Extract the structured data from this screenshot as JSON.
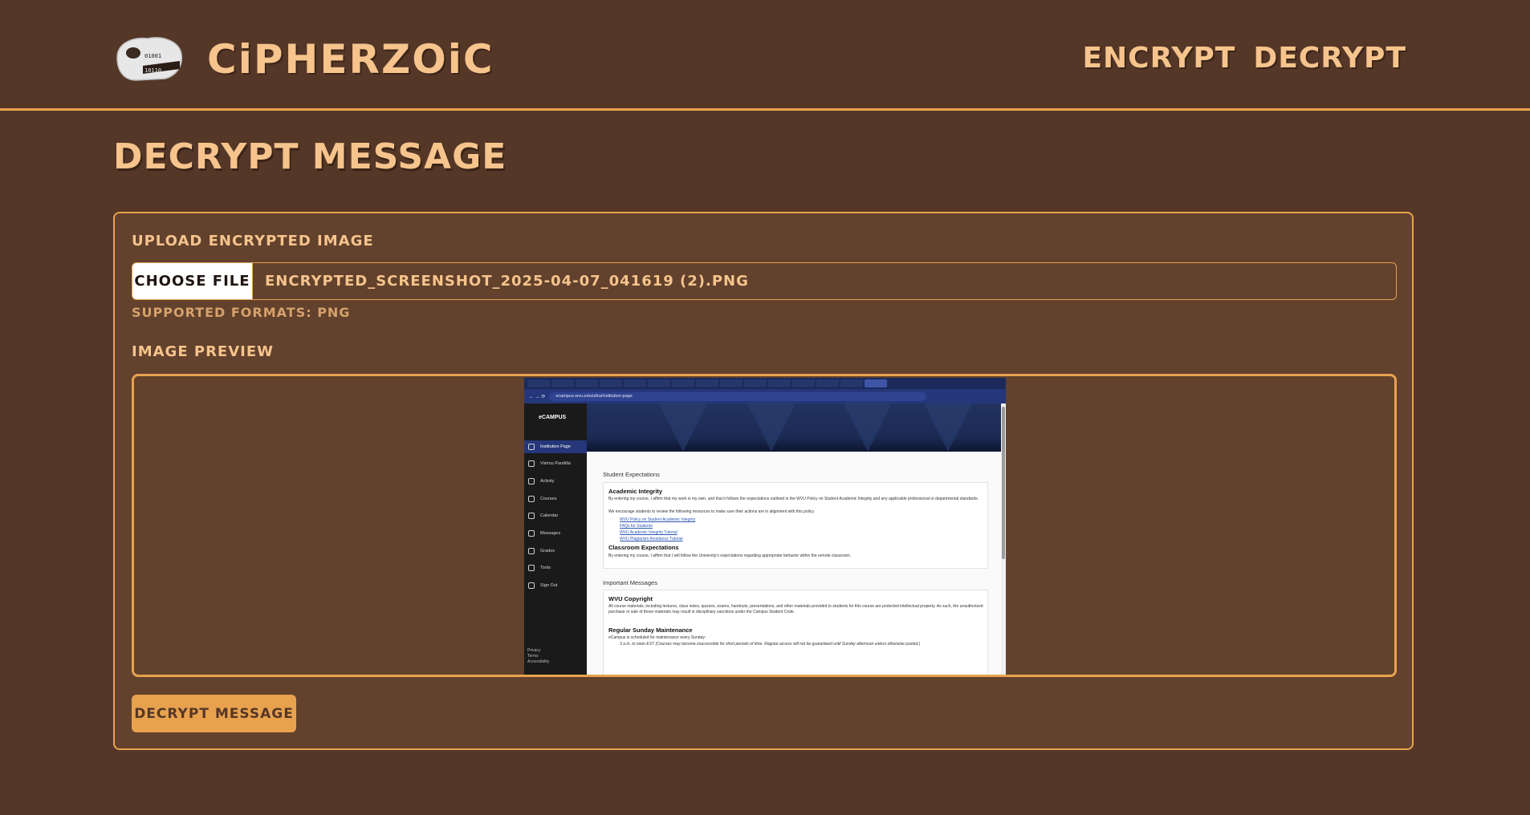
{
  "header": {
    "brand": "CiPHERZOiC",
    "nav": [
      "ENCRYPT",
      "DECRYPT"
    ]
  },
  "page": {
    "title": "DECRYPT MESSAGE"
  },
  "upload": {
    "label": "UPLOAD ENCRYPTED iMAGE",
    "choose_label": "CHOOSE FiLE",
    "file_name": "ENCRYPTED_SCREENSHOT_2025-04-07_041619 (2).PNG",
    "hint": "SUPPORTED FORMATS: PNG"
  },
  "preview": {
    "label": "iMAGE PREViEW",
    "shot": {
      "url": "ecampus.wvu.edu/ultra/institution-page",
      "logo": "eCAMPUS",
      "side_items": [
        "Institution Page",
        "Vishnu Pandilla",
        "Activity",
        "Courses",
        "Calendar",
        "Messages",
        "Grades",
        "Tools",
        "Sign Out"
      ],
      "side_footer": [
        "Privacy",
        "Terms",
        "Accessibility"
      ],
      "section1_title": "Student Expectations",
      "academic_integrity_heading": "Academic Integrity",
      "academic_integrity_text": "By entering my course, I affirm that my work is my own, and that it follows the expectations outlined in the WVU Policy on Student Academic Integrity and any applicable professional or departmental standards.",
      "academic_integrity_text2": "We encourage students to review the following resources to make sure their actions are in alignment with this policy.",
      "links": [
        "WVU Policy on Student Academic Integrity",
        "FAQs for Students",
        "WVU Academic Integrity Tutorial",
        "WVU Plagiarism Avoidance Tutorial"
      ],
      "classroom_heading": "Classroom Expectations",
      "classroom_text": "By entering my course, I affirm that I will follow the University's expectations regarding appropriate behavior within the remote classroom.",
      "section2_title": "Important Messages",
      "copyright_heading": "WVU Copyright",
      "copyright_text": "All course materials, including lectures, class notes, quizzes, exams, handouts, presentations, and other materials provided to students for this course are protected intellectual property. As such, the unauthorized purchase or sale of these materials may result in disciplinary sanctions under the Campus Student Code.",
      "maintenance_heading": "Regular Sunday Maintenance",
      "maintenance_text": "eCampus is scheduled for maintenance every Sunday:",
      "maintenance_item": "3 a.m. to noon EST (Courses may become inaccessible for short periods of time. Regular access will not be guaranteed until Sunday afternoon unless otherwise posted.)"
    }
  },
  "actions": {
    "decrypt_label": "DECRYPT MESSAGE"
  },
  "colors": {
    "background": "#553727",
    "card": "#62412d",
    "accent": "#e8a24e",
    "text": "#f6c48c"
  }
}
